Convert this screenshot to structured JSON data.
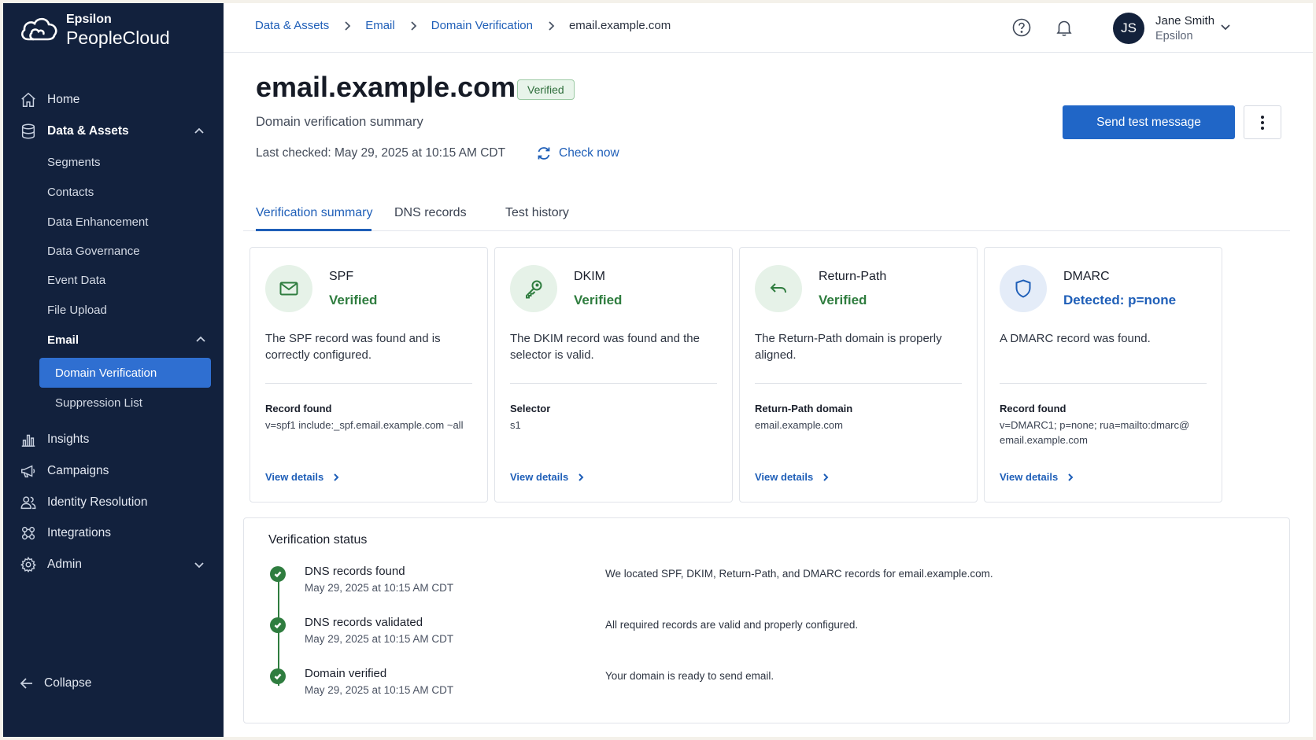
{
  "brand": {
    "line1": "Epsilon",
    "line2": "PeopleCloud"
  },
  "sidebar": {
    "items": [
      {
        "label": "Home",
        "icon": "home-icon"
      },
      {
        "label": "Data & Assets",
        "icon": "database-icon"
      },
      {
        "label": "Insights",
        "icon": "bar-chart-icon"
      },
      {
        "label": "Campaigns",
        "icon": "megaphone-icon"
      },
      {
        "label": "Identity Resolution",
        "icon": "people-icon"
      },
      {
        "label": "Integrations",
        "icon": "integrations-icon"
      },
      {
        "label": "Admin",
        "icon": "gear-icon"
      }
    ],
    "data_assets_sub": [
      "Segments",
      "Contacts",
      "Data Enhancement",
      "Data Governance",
      "Event Data",
      "File Upload",
      "Email"
    ],
    "email_sub": [
      "Domain Verification",
      "Suppression List"
    ],
    "collapse_label": "Collapse"
  },
  "breadcrumb": [
    "Data & Assets",
    "Email",
    "Domain Verification",
    "email.example.com"
  ],
  "user": {
    "initials": "JS",
    "name": "Jane Smith",
    "org": "Epsilon"
  },
  "page": {
    "title": "email.example.com",
    "badge": "Verified",
    "subtitle": "Domain verification summary",
    "last_checked": "Last checked: May 29, 2025 at 10:15 AM CDT",
    "check_now": "Check now",
    "send_test": "Send test message"
  },
  "tabs": [
    "Verification summary",
    "DNS records",
    "Test history"
  ],
  "cards": [
    {
      "name": "SPF",
      "status": "Verified",
      "desc": "The SPF record was found and is correctly configured.",
      "record_label": "Record found",
      "record_value": "v=spf1 include:_spf.email.example.com ~all",
      "link": "View details",
      "icon": "envelope-icon"
    },
    {
      "name": "DKIM",
      "status": "Verified",
      "desc": "The DKIM record was found and the selector is valid.",
      "record_label": "Selector",
      "record_value": "s1",
      "link": "View details",
      "icon": "key-icon"
    },
    {
      "name": "Return-Path",
      "status": "Verified",
      "desc": "The Return-Path domain is properly aligned.",
      "record_label": "Return-Path domain",
      "record_value": "email.example.com",
      "link": "View details",
      "icon": "return-arrow-icon"
    },
    {
      "name": "DMARC",
      "status": "Detected: p=none",
      "desc": "A DMARC record was found.",
      "record_label": "Record found",
      "record_value": "v=DMARC1; p=none; rua=mailto:dmarc@ email.example.com",
      "link": "View details",
      "icon": "shield-icon"
    }
  ],
  "verification_status": {
    "title": "Verification status",
    "steps": [
      {
        "title": "DNS records found",
        "time": "May 29, 2025 at 10:15 AM CDT",
        "message": "We located SPF, DKIM, Return-Path, and DMARC records for email.example.com."
      },
      {
        "title": "DNS records validated",
        "time": "May 29, 2025 at 10:15 AM CDT",
        "message": "All required records are valid and properly configured."
      },
      {
        "title": "Domain verified",
        "time": "May 29, 2025 at 10:15 AM CDT",
        "message": "Your domain is ready to send email."
      }
    ]
  },
  "colors": {
    "sidebar_bg": "#12213d",
    "accent": "#2066c7",
    "success": "#2f7d3f",
    "info": "#1f5fb8"
  }
}
